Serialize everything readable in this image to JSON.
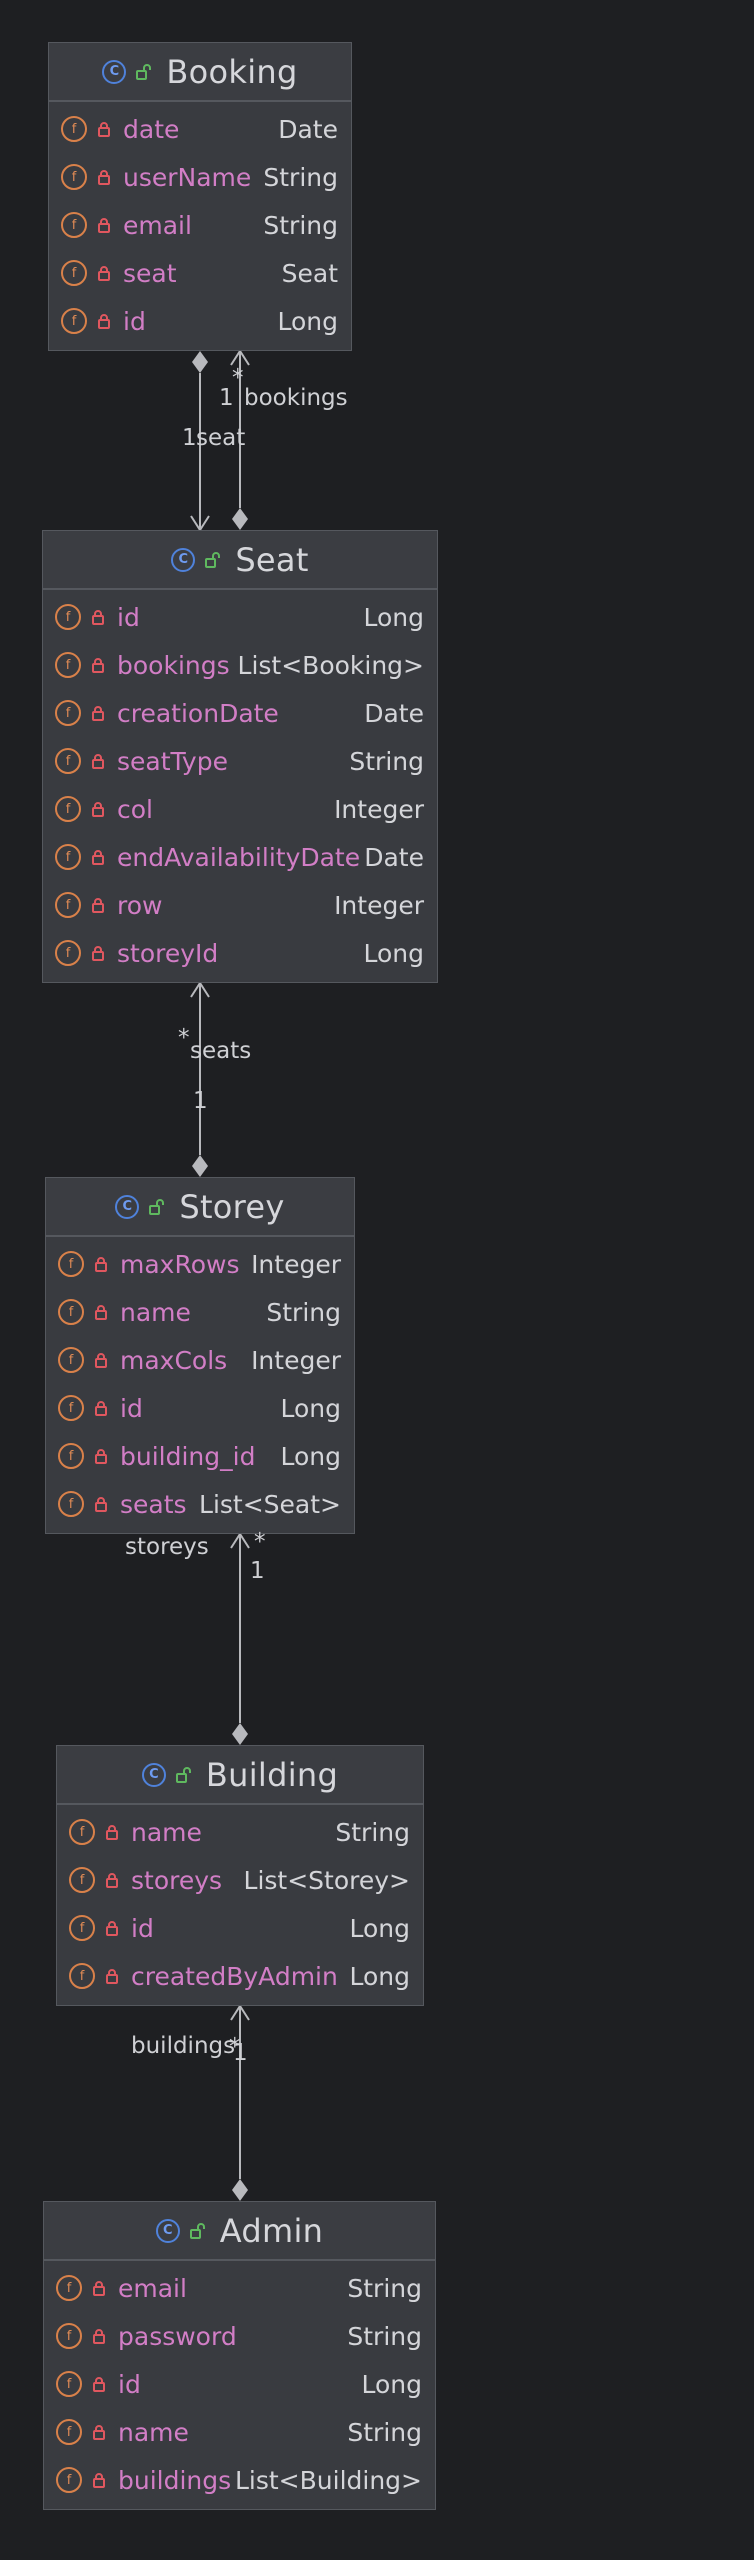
{
  "classes": [
    {
      "id": "booking",
      "name": "Booking",
      "fields": [
        {
          "name": "date",
          "type": "Date"
        },
        {
          "name": "userName",
          "type": "String"
        },
        {
          "name": "email",
          "type": "String"
        },
        {
          "name": "seat",
          "type": "Seat"
        },
        {
          "name": "id",
          "type": "Long"
        }
      ]
    },
    {
      "id": "seat",
      "name": "Seat",
      "fields": [
        {
          "name": "id",
          "type": "Long"
        },
        {
          "name": "bookings",
          "type": "List<Booking>"
        },
        {
          "name": "creationDate",
          "type": "Date"
        },
        {
          "name": "seatType",
          "type": "String"
        },
        {
          "name": "col",
          "type": "Integer"
        },
        {
          "name": "endAvailabilityDate",
          "type": "Date"
        },
        {
          "name": "row",
          "type": "Integer"
        },
        {
          "name": "storeyId",
          "type": "Long"
        }
      ]
    },
    {
      "id": "storey",
      "name": "Storey",
      "fields": [
        {
          "name": "maxRows",
          "type": "Integer"
        },
        {
          "name": "name",
          "type": "String"
        },
        {
          "name": "maxCols",
          "type": "Integer"
        },
        {
          "name": "id",
          "type": "Long"
        },
        {
          "name": "building_id",
          "type": "Long"
        },
        {
          "name": "seats",
          "type": "List<Seat>"
        }
      ]
    },
    {
      "id": "building",
      "name": "Building",
      "fields": [
        {
          "name": "name",
          "type": "String"
        },
        {
          "name": "storeys",
          "type": "List<Storey>"
        },
        {
          "name": "id",
          "type": "Long"
        },
        {
          "name": "createdByAdmin",
          "type": "Long"
        }
      ]
    },
    {
      "id": "admin",
      "name": "Admin",
      "fields": [
        {
          "name": "email",
          "type": "String"
        },
        {
          "name": "password",
          "type": "String"
        },
        {
          "name": "id",
          "type": "Long"
        },
        {
          "name": "name",
          "type": "String"
        },
        {
          "name": "buildings",
          "type": "List<Building>"
        }
      ]
    }
  ],
  "relations": {
    "booking_seat": {
      "multiplicity": "1",
      "role": "seat"
    },
    "seat_bookings": {
      "multiplicity_one": "1",
      "role": "bookings",
      "multiplicity_many": "*"
    },
    "storey_seats": {
      "multiplicity_many": "*",
      "role": "seats",
      "multiplicity_one": "1"
    },
    "building_storeys": {
      "role": "storeys",
      "multiplicity_many": "*",
      "multiplicity_one": "1"
    },
    "admin_buildings": {
      "role": "buildings",
      "multiplicity_many": "*",
      "multiplicity_one": "1"
    }
  },
  "icons": {
    "class": "C",
    "field": "f",
    "class_icon": "class-c-icon",
    "field_icon": "field-f-icon",
    "access_icon": "lock-icon",
    "visibility_icon": "unlock-icon"
  },
  "colors": {
    "background": "#1e1f22",
    "box": "#393b40",
    "field_name": "#d27ec6",
    "type": "#d4d5d9",
    "class_icon": "#4f82db",
    "field_icon": "#d9814a",
    "lock": "#e0575f",
    "unlock": "#5fb95f",
    "edge": "#b8b9bd"
  }
}
